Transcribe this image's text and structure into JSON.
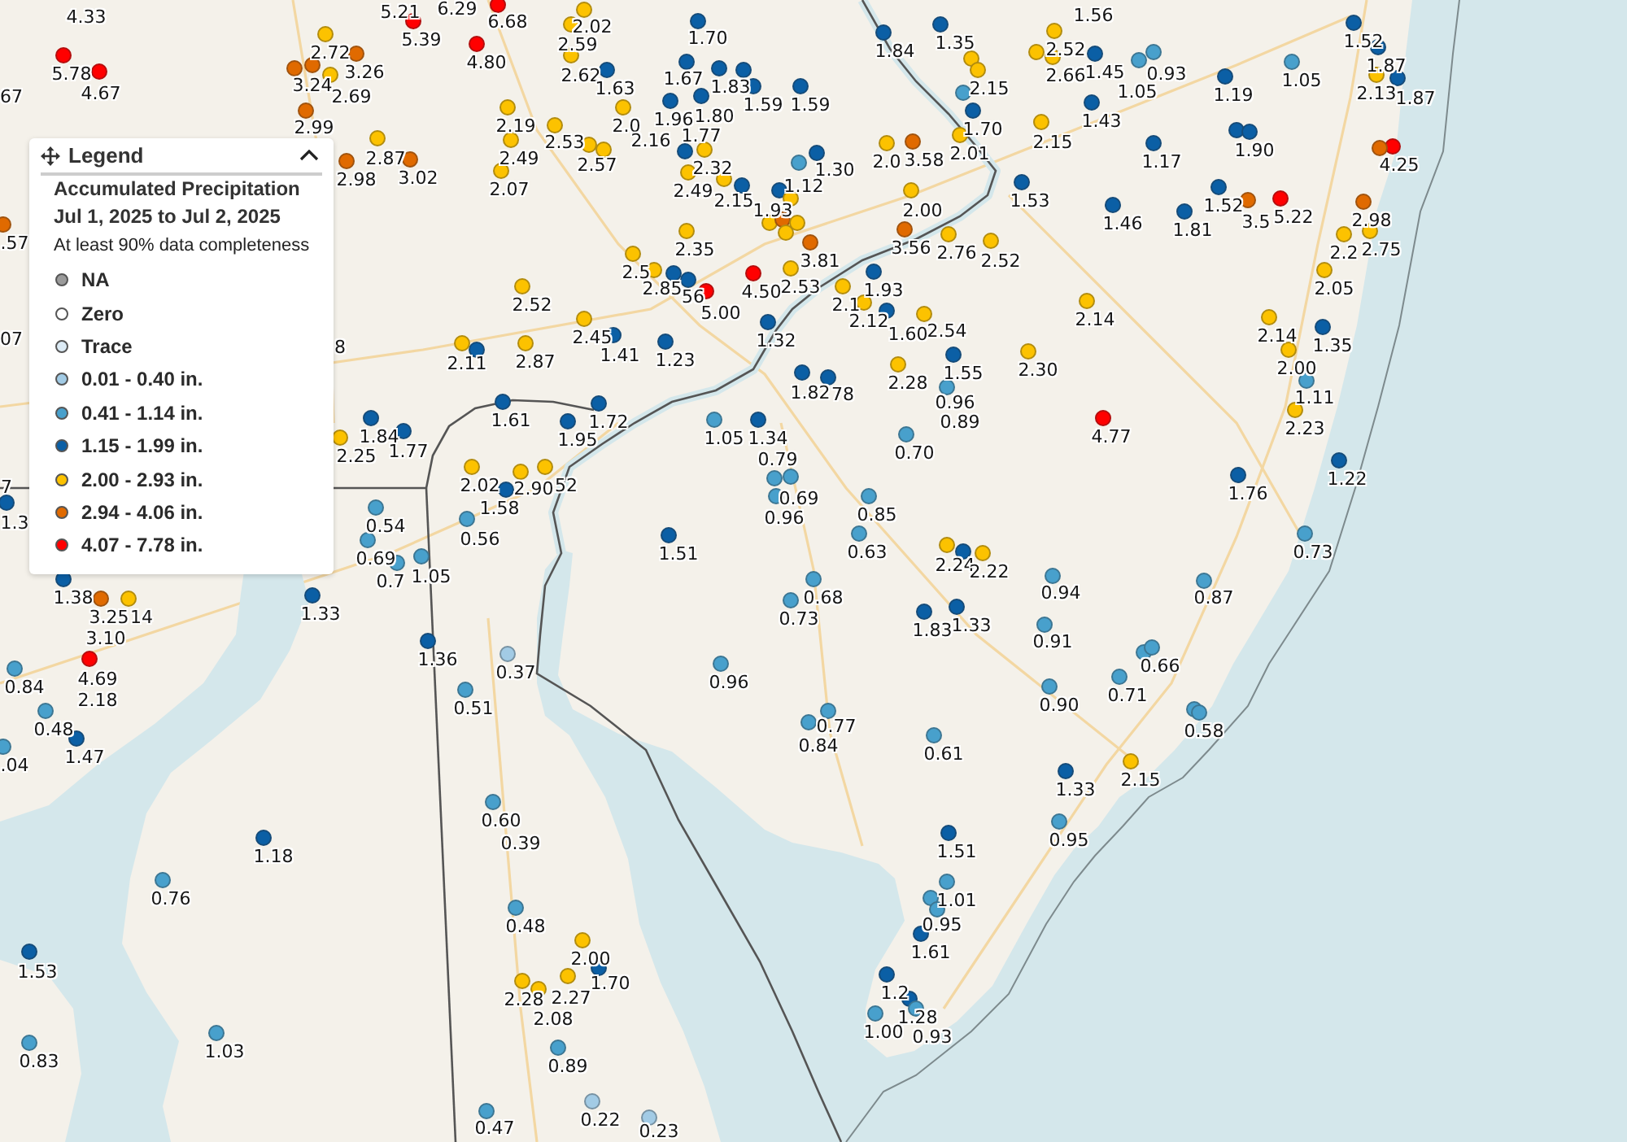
{
  "legend": {
    "title": "Legend",
    "expanded": true,
    "heading": "Accumulated Precipitation",
    "period": "Jul 1, 2025 to Jul 2, 2025",
    "note": "At least 90% data completeness",
    "items": [
      {
        "label": "NA",
        "color": "#9b9b9b"
      },
      {
        "label": "Zero",
        "color": "#ffffff"
      },
      {
        "label": "Trace",
        "color": "#dcebf5"
      },
      {
        "label": "0.01 - 0.40 in.",
        "color": "#a2cbe5"
      },
      {
        "label": "0.41 - 1.14 in.",
        "color": "#48a0cc"
      },
      {
        "label": "1.15 - 1.99 in.",
        "color": "#0b5fa5"
      },
      {
        "label": "2.00 - 2.93 in.",
        "color": "#fcc200"
      },
      {
        "label": "2.94 - 4.06 in.",
        "color": "#e06a00"
      },
      {
        "label": "4.07 - 7.78 in.",
        "color": "#ff0000"
      }
    ]
  },
  "stations": [
    {
      "value": "4.33"
    },
    {
      "value": "5.21"
    },
    {
      "value": "6.29"
    },
    {
      "value": "6.68",
      "color": "#ff0000"
    },
    {
      "value": "5.39",
      "color": "#ff0000"
    },
    {
      "value": "2.72",
      "color": "#fcc200"
    },
    {
      "value": "4.80",
      "color": "#ff0000"
    },
    {
      "value": "5.78",
      "color": "#ff0000"
    },
    {
      "value": "3.26",
      "color": "#e06a00"
    },
    {
      "color": "#e06a00"
    },
    {
      "value": "3.24",
      "color": "#e06a00"
    },
    {
      "value": "67"
    },
    {
      "value": "4.67",
      "color": "#ff0000"
    },
    {
      "value": "2.69",
      "color": "#fcc200"
    },
    {
      "value": "2.99",
      "color": "#e06a00"
    },
    {
      "value": "2.19",
      "color": "#fcc200"
    },
    {
      "value": "2.87",
      "color": "#fcc200"
    },
    {
      "value": "2.49",
      "color": "#fcc200"
    },
    {
      "value": "2.98",
      "color": "#e06a00"
    },
    {
      "value": "3.02",
      "color": "#e06a00"
    },
    {
      "value": "2.07",
      "color": "#fcc200"
    },
    {
      "value": ".57",
      "color": "#e06a00"
    },
    {
      "value": "07"
    },
    {
      "value": "8"
    },
    {
      "value": "2.52",
      "color": "#fcc200"
    },
    {
      "value": "2.11",
      "color": "#fcc200"
    },
    {
      "color": "#0b5fa5"
    },
    {
      "value": "2.87",
      "color": "#fcc200"
    },
    {
      "value": "1.61",
      "color": "#0b5fa5"
    },
    {
      "value": "1.84",
      "color": "#0b5fa5"
    },
    {
      "value": "2.25",
      "color": "#fcc200"
    },
    {
      "value": "1.77",
      "color": "#0b5fa5"
    },
    {
      "value": "2.02",
      "color": "#fcc200"
    },
    {
      "value": "2.90",
      "color": "#fcc200"
    },
    {
      "value": "52",
      "color": "#fcc200"
    },
    {
      "value": "1.58",
      "color": "#0b5fa5"
    },
    {
      "value": "0.54",
      "color": "#48a0cc"
    },
    {
      "value": "0.56",
      "color": "#48a0cc"
    },
    {
      "value": "0.69",
      "color": "#48a0cc"
    },
    {
      "value": "0.7",
      "color": "#48a0cc"
    },
    {
      "value": "1.05",
      "color": "#48a0cc"
    },
    {
      "value": "7"
    },
    {
      "value": "1.3",
      "color": "#0b5fa5"
    },
    {
      "value": "2.02",
      "color": "#fcc200"
    },
    {
      "value": "2.59",
      "color": "#fcc200"
    },
    {
      "value": "2.62",
      "color": "#fcc200"
    },
    {
      "value": "1.63",
      "color": "#0b5fa5"
    },
    {
      "value": "1.70",
      "color": "#0b5fa5"
    },
    {
      "value": "1.67",
      "color": "#0b5fa5"
    },
    {
      "value": "1.83",
      "color": "#0b5fa5"
    },
    {
      "color": "#0b5fa5"
    },
    {
      "value": "1.59",
      "color": "#0b5fa5"
    },
    {
      "value": "1.59",
      "color": "#0b5fa5"
    },
    {
      "value": "2.0",
      "color": "#fcc200"
    },
    {
      "value": "1.96",
      "color": "#0b5fa5"
    },
    {
      "value": "1.80",
      "color": "#0b5fa5"
    },
    {
      "value": "2.53",
      "color": "#fcc200"
    },
    {
      "value": "2.16"
    },
    {
      "value": "2.57",
      "color": "#fcc200"
    },
    {
      "color": "#fcc200"
    },
    {
      "value": "1.77"
    },
    {
      "color": "#0b5fa5"
    },
    {
      "value": "2.32",
      "color": "#fcc200"
    },
    {
      "value": "1.30",
      "color": "#0b5fa5"
    },
    {
      "value": "2.49",
      "color": "#fcc200"
    },
    {
      "value": "1.12",
      "color": "#48a0cc"
    },
    {
      "value": "2.15",
      "color": "#fcc200"
    },
    {
      "value": "1.93",
      "color": "#0b5fa5"
    },
    {
      "color": "#0b5fa5"
    },
    {
      "color": "#fcc200"
    },
    {
      "color": "#fcc200"
    },
    {
      "color": "#e06a00"
    },
    {
      "color": "#fcc200"
    },
    {
      "color": "#fcc200"
    },
    {
      "value": "3.81",
      "color": "#e06a00"
    },
    {
      "value": "2.53",
      "color": "#fcc200"
    },
    {
      "value": "2.35",
      "color": "#fcc200"
    },
    {
      "value": "2.5",
      "color": "#fcc200"
    },
    {
      "value": "2.85",
      "color": "#fcc200"
    },
    {
      "color": "#0b5fa5"
    },
    {
      "value": "56",
      "color": "#0b5fa5"
    },
    {
      "value": "4.50",
      "color": "#ff0000"
    },
    {
      "value": "5.00",
      "color": "#ff0000"
    },
    {
      "value": "1.32",
      "color": "#0b5fa5"
    },
    {
      "value": "1.93",
      "color": "#0b5fa5"
    },
    {
      "value": "2.1",
      "color": "#fcc200"
    },
    {
      "value": "2.12",
      "color": "#fcc200"
    },
    {
      "value": "1.60",
      "color": "#0b5fa5"
    },
    {
      "value": "2.54",
      "color": "#fcc200"
    },
    {
      "value": "1.84",
      "color": "#0b5fa5"
    },
    {
      "value": "1.35",
      "color": "#0b5fa5"
    },
    {
      "color": "#fcc200"
    },
    {
      "color": "#fcc200"
    },
    {
      "value": "2.52",
      "color": "#fcc200"
    },
    {
      "value": "2.66",
      "color": "#fcc200"
    },
    {
      "value": "2.15",
      "color": "#fcc200"
    },
    {
      "color": "#48a0cc"
    },
    {
      "value": "1.70",
      "color": "#0b5fa5"
    },
    {
      "value": "2.15",
      "color": "#fcc200"
    },
    {
      "value": "2.0",
      "color": "#fcc200"
    },
    {
      "value": "3.58",
      "color": "#e06a00"
    },
    {
      "value": "2.01",
      "color": "#fcc200"
    },
    {
      "value": "2.00",
      "color": "#fcc200"
    },
    {
      "value": "1.53",
      "color": "#0b5fa5"
    },
    {
      "value": "3.56",
      "color": "#e06a00"
    },
    {
      "value": "2.76",
      "color": "#fcc200"
    },
    {
      "value": "2.52",
      "color": "#fcc200"
    },
    {
      "value": "2.28",
      "color": "#fcc200"
    },
    {
      "value": "1.55",
      "color": "#0b5fa5"
    },
    {
      "value": "2.30",
      "color": "#fcc200"
    },
    {
      "value": "0.96",
      "color": "#48a0cc"
    },
    {
      "value": "0.89"
    },
    {
      "value": "1.82",
      "color": "#0b5fa5"
    },
    {
      "value": "78",
      "color": "#0b5fa5"
    },
    {
      "value": "1.23",
      "color": "#0b5fa5"
    },
    {
      "value": "2.45",
      "color": "#fcc200"
    },
    {
      "value": "1.41",
      "color": "#0b5fa5"
    },
    {
      "value": "1.72",
      "color": "#0b5fa5"
    },
    {
      "value": "1.95",
      "color": "#0b5fa5"
    },
    {
      "value": "1.05",
      "color": "#48a0cc"
    },
    {
      "value": "1.34",
      "color": "#0b5fa5"
    },
    {
      "value": "0.79"
    },
    {
      "color": "#48a0cc"
    },
    {
      "color": "#48a0cc"
    },
    {
      "value": "0.69",
      "color": "#48a0cc"
    },
    {
      "value": "0.96"
    },
    {
      "value": "0.85",
      "color": "#48a0cc"
    },
    {
      "value": "0.63",
      "color": "#48a0cc"
    },
    {
      "value": "0.70",
      "color": "#48a0cc"
    },
    {
      "value": "1.51",
      "color": "#0b5fa5"
    },
    {
      "value": "2.24",
      "color": "#fcc200"
    },
    {
      "color": "#0b5fa5"
    },
    {
      "value": "2.22",
      "color": "#fcc200"
    },
    {
      "value": "1.56"
    },
    {
      "value": "1.52",
      "color": "#0b5fa5"
    },
    {
      "value": "1.45",
      "color": "#0b5fa5"
    },
    {
      "value": "0.93",
      "color": "#48a0cc"
    },
    {
      "value": "1.05",
      "color": "#48a0cc"
    },
    {
      "value": "1.87",
      "color": "#0b5fa5"
    },
    {
      "value": "1.05",
      "color": "#48a0cc"
    },
    {
      "value": "1.19",
      "color": "#0b5fa5"
    },
    {
      "value": "2.13",
      "color": "#fcc200"
    },
    {
      "value": "1.87",
      "color": "#0b5fa5"
    },
    {
      "color": "#0b5fa5"
    },
    {
      "value": "1.43",
      "color": "#0b5fa5"
    },
    {
      "value": "1.90",
      "color": "#0b5fa5"
    },
    {
      "value": "1.17",
      "color": "#0b5fa5"
    },
    {
      "value": "4.25",
      "color": "#ff0000"
    },
    {
      "color": "#e06a00"
    },
    {
      "value": "1.52",
      "color": "#0b5fa5"
    },
    {
      "value": "1.46",
      "color": "#0b5fa5"
    },
    {
      "value": "1.81",
      "color": "#0b5fa5"
    },
    {
      "value": "3.5",
      "color": "#e06a00"
    },
    {
      "value": "5.22",
      "color": "#ff0000"
    },
    {
      "value": "2.98",
      "color": "#e06a00"
    },
    {
      "value": "2.2",
      "color": "#fcc200"
    },
    {
      "value": "2.75",
      "color": "#fcc200"
    },
    {
      "value": "2.05",
      "color": "#fcc200"
    },
    {
      "value": "2.14",
      "color": "#fcc200"
    },
    {
      "value": "2.14",
      "color": "#fcc200"
    },
    {
      "value": "1.35",
      "color": "#0b5fa5"
    },
    {
      "value": "2.00",
      "color": "#fcc200"
    },
    {
      "value": "1.11",
      "color": "#48a0cc"
    },
    {
      "value": "4.77",
      "color": "#ff0000"
    },
    {
      "value": "2.23",
      "color": "#fcc200"
    },
    {
      "value": "1.22",
      "color": "#0b5fa5"
    },
    {
      "value": "1.76",
      "color": "#0b5fa5"
    },
    {
      "value": "0.73",
      "color": "#48a0cc"
    },
    {
      "value": "1.38",
      "color": "#0b5fa5"
    },
    {
      "value": "3.25",
      "color": "#e06a00"
    },
    {
      "value": "14",
      "color": "#fcc200"
    },
    {
      "value": "3.10"
    },
    {
      "value": "4.69",
      "color": "#ff0000"
    },
    {
      "value": "2.18"
    },
    {
      "value": "0.84",
      "color": "#48a0cc"
    },
    {
      "value": "0.48",
      "color": "#48a0cc"
    },
    {
      "value": ".04",
      "color": "#48a0cc"
    },
    {
      "value": "1.47",
      "color": "#0b5fa5"
    },
    {
      "value": "1.33",
      "color": "#0b5fa5"
    },
    {
      "value": "1.36",
      "color": "#0b5fa5"
    },
    {
      "value": "0.37",
      "color": "#a2cbe5"
    },
    {
      "value": "0.51",
      "color": "#48a0cc"
    },
    {
      "value": "0.60",
      "color": "#48a0cc"
    },
    {
      "value": "0.39"
    },
    {
      "value": "1.18",
      "color": "#0b5fa5"
    },
    {
      "value": "0.76",
      "color": "#48a0cc"
    },
    {
      "value": "1.53",
      "color": "#0b5fa5"
    },
    {
      "value": "0.83",
      "color": "#48a0cc"
    },
    {
      "value": "1.03",
      "color": "#48a0cc"
    },
    {
      "value": "0.48",
      "color": "#48a0cc"
    },
    {
      "value": "2.28",
      "color": "#fcc200"
    },
    {
      "value": "2.08",
      "color": "#fcc200"
    },
    {
      "value": "0.47",
      "color": "#48a0cc"
    },
    {
      "value": "0.68",
      "color": "#48a0cc"
    },
    {
      "value": "0.73",
      "color": "#48a0cc"
    },
    {
      "value": "1.83",
      "color": "#0b5fa5"
    },
    {
      "value": "1.33",
      "color": "#0b5fa5"
    },
    {
      "value": "0.94",
      "color": "#48a0cc"
    },
    {
      "value": "0.91",
      "color": "#48a0cc"
    },
    {
      "value": "0.90",
      "color": "#48a0cc"
    },
    {
      "value": "0.96",
      "color": "#48a0cc"
    },
    {
      "value": "0.77",
      "color": "#48a0cc"
    },
    {
      "value": "0.84",
      "color": "#48a0cc"
    },
    {
      "value": "0.61",
      "color": "#48a0cc"
    },
    {
      "value": "1.33",
      "color": "#0b5fa5"
    },
    {
      "value": "0.95",
      "color": "#48a0cc"
    },
    {
      "value": "1.51",
      "color": "#0b5fa5"
    },
    {
      "color": "#48a0cc"
    },
    {
      "value": "1.01",
      "color": "#48a0cc"
    },
    {
      "value": "0.95",
      "color": "#48a0cc"
    },
    {
      "value": "1.61",
      "color": "#0b5fa5"
    },
    {
      "value": "1.2",
      "color": "#0b5fa5"
    },
    {
      "value": "1.28",
      "color": "#0b5fa5"
    },
    {
      "value": "1.00",
      "color": "#48a0cc"
    },
    {
      "value": "0.93",
      "color": "#48a0cc"
    },
    {
      "value": "2.00",
      "color": "#fcc200"
    },
    {
      "value": "1.70",
      "color": "#0b5fa5"
    },
    {
      "value": "2.27",
      "color": "#fcc200"
    },
    {
      "value": "0.89",
      "color": "#48a0cc"
    },
    {
      "value": "0.22",
      "color": "#a2cbe5"
    },
    {
      "value": "0.23",
      "color": "#a2cbe5"
    },
    {
      "value": "0.87",
      "color": "#48a0cc"
    },
    {
      "color": "#48a0cc"
    },
    {
      "value": "0.66",
      "color": "#48a0cc"
    },
    {
      "value": "0.71",
      "color": "#48a0cc"
    },
    {
      "color": "#48a0cc"
    },
    {
      "value": "0.58",
      "color": "#48a0cc"
    },
    {
      "value": "2.15",
      "color": "#fcc200"
    }
  ]
}
